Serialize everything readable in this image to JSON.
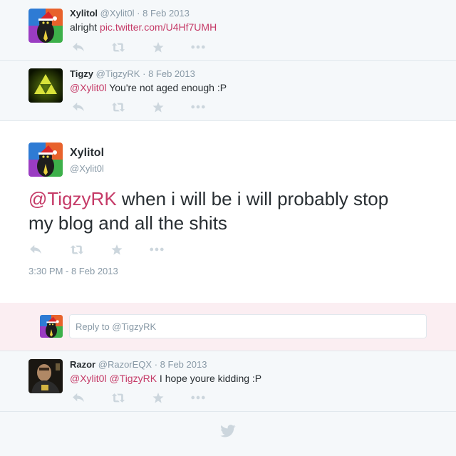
{
  "tweets": [
    {
      "name": "Xylitol",
      "handle": "@Xylit0l",
      "date": "8 Feb 2013",
      "text_pre": "alright ",
      "link": "pic.twitter.com/U4Hf7UMH"
    },
    {
      "name": "Tigzy",
      "handle": "@TigzyRK",
      "date": "8 Feb 2013",
      "mention": "@Xylit0l",
      "text": " You're not aged enough :P"
    }
  ],
  "main_tweet": {
    "name": "Xylitol",
    "handle": "@Xylit0l",
    "mention": "@TigzyRK",
    "text_line1": " when i will be i will probably stop",
    "text_line2": "my blog and all the shits",
    "timestamp": "3:30 PM - 8 Feb 2013"
  },
  "reply_box": {
    "placeholder": "Reply to @TigzyRK"
  },
  "reply_tweet": {
    "name": "Razor",
    "handle": "@RazorEQX",
    "date": "8 Feb 2013",
    "mention1": "@Xylit0l",
    "mention2": "@TigzyRK",
    "text": " I hope youre kidding :P"
  },
  "icons": {
    "reply": "reply-icon",
    "retweet": "retweet-icon",
    "favorite": "star-icon",
    "more": "more-icon",
    "footer": "twitter-bird-icon"
  },
  "colors": {
    "mention": "#c53a67",
    "muted": "#8899a6",
    "reply_bg": "#fbeef2"
  }
}
